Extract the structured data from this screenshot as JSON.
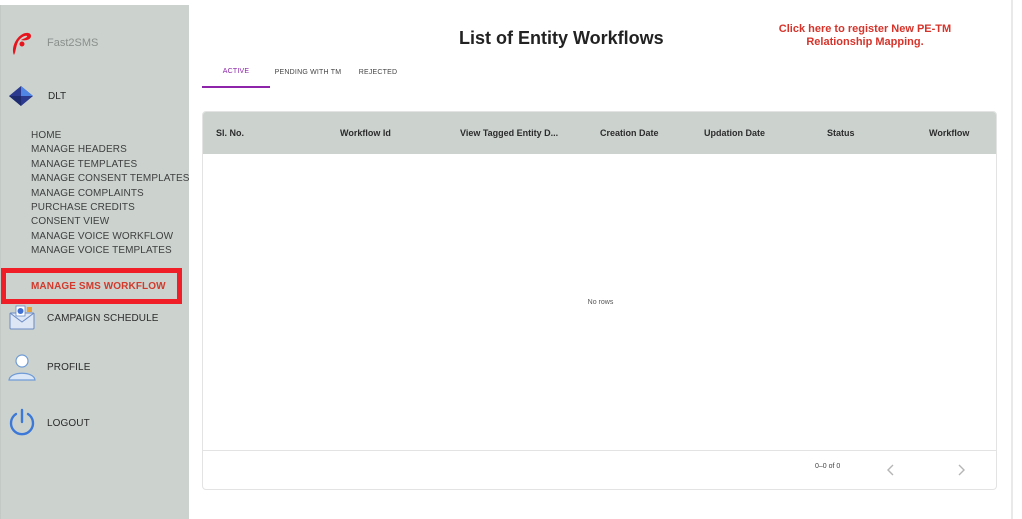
{
  "brand": {
    "name": "Fast2SMS"
  },
  "sidebar": {
    "section": "DLT",
    "menu": [
      "HOME",
      "MANAGE HEADERS",
      "MANAGE TEMPLATES",
      "MANAGE CONSENT TEMPLATES",
      "MANAGE COMPLAINTS",
      "PURCHASE CREDITS",
      "CONSENT VIEW",
      "MANAGE VOICE WORKFLOW",
      "MANAGE VOICE TEMPLATES"
    ],
    "active_item": "MANAGE SMS WORKFLOW",
    "campaign": "CAMPAIGN SCHEDULE",
    "profile": "PROFILE",
    "logout": "LOGOUT"
  },
  "header": {
    "title": "List of Entity Workflows",
    "register_link": "Click here to register New PE-TM Relationship Mapping."
  },
  "tabs": [
    "ACTIVE",
    "PENDING WITH TM",
    "REJECTED"
  ],
  "grid": {
    "columns": [
      "Sl. No.",
      "Workflow Id",
      "View Tagged Entity D...",
      "Creation Date",
      "Updation Date",
      "Status",
      "Workflow"
    ],
    "empty_text": "No rows",
    "pagination": "0–0 of 0"
  },
  "colors": {
    "accent_tab": "#8e24aa",
    "active_menu_text": "#d13a2c",
    "highlight_border": "#f01e26",
    "register_link": "#d6342b",
    "sidebar_bg": "#ccd3cf"
  },
  "icons": {
    "brand": "fast2sms-logo-icon",
    "dlt": "dlt-diamond-icon",
    "campaign": "campaign-mail-icon",
    "profile": "user-avatar-icon",
    "logout": "power-icon",
    "prev": "chevron-left-icon",
    "next": "chevron-right-icon"
  }
}
